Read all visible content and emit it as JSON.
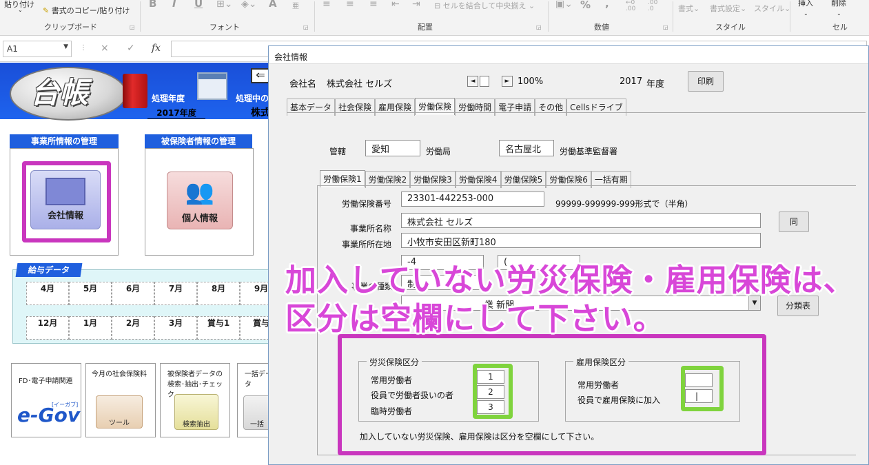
{
  "ribbon": {
    "paste_label": "貼り付け",
    "copy_format_label": "書式のコピー/貼り付け",
    "merge_label": "セルを結合して中央揃え",
    "percent": "%",
    "comma": ",",
    "inc_decimal": ".00",
    "dec_decimal": ".0",
    "cell_format": "書式",
    "format_settings": "書式設定",
    "style_btn": "スタイル",
    "insert": "挿入",
    "delete": "削除",
    "bold": "B",
    "italic": "I",
    "underline": "U",
    "font_color": "A",
    "groups": {
      "clipboard": "クリップボード",
      "font": "フォント",
      "alignment": "配置",
      "number": "数値",
      "style": "スタイル",
      "cells": "セル"
    }
  },
  "formula_bar": {
    "name_box": "A1",
    "cancel": "×",
    "enter": "✓",
    "fx": "fx",
    "value": ""
  },
  "sheet": {
    "logo_text": "台帳",
    "processing_year_label": "処理年度",
    "processing_year_value": "2017年度",
    "processing_company_label": "処理中の",
    "processing_company_value": "株式",
    "office_mgmt_header": "事業所情報の管理",
    "insured_mgmt_header": "被保険者情報の管理",
    "company_info_button": "会社情報",
    "personal_info_button": "個人情報",
    "salary_data_tab": "給与データ",
    "months_row1": [
      "4月",
      "5月",
      "6月",
      "7月",
      "8月",
      "9月"
    ],
    "months_row2": [
      "12月",
      "1月",
      "2月",
      "3月",
      "賞与1",
      "賞与"
    ],
    "tools": [
      {
        "title": "FD･電子申請関連",
        "icon_label": "e-Gov",
        "icon_sub": "[イーガブ]"
      },
      {
        "title": "今月の社会保険料",
        "icon_label": "ツール"
      },
      {
        "title": "被保険者データの検索･抽出･チェック",
        "icon_label": "検索抽出"
      },
      {
        "title": "一括データ",
        "icon_label": "一括"
      }
    ]
  },
  "dialog": {
    "title": "会社情報",
    "company_label": "会社名",
    "company_name": "株式会社 セルズ",
    "zoom_prev": "◄",
    "zoom_next": "►",
    "zoom": "100%",
    "year": "2017",
    "year_suffix": "年度",
    "print_button": "印刷",
    "tabs": [
      "基本データ",
      "社会保険",
      "雇用保険",
      "労働保険",
      "労働時間",
      "電子申請",
      "その他",
      "Cellsドライブ"
    ],
    "active_tab": "労働保険",
    "jurisdiction_label": "管轄",
    "prefecture": "愛知",
    "labor_bureau_label": "労働局",
    "inspection_office": "名古屋北",
    "inspection_office_label": "労働基準監督署",
    "sub_tabs": [
      "労働保険1",
      "労働保険2",
      "労働保険3",
      "労働保険4",
      "労働保険5",
      "労働保険6",
      "一括有期"
    ],
    "active_sub_tab": "労働保険1",
    "insurance_number_label": "労働保険番号",
    "insurance_number": "23301-442253-000",
    "insurance_number_format": "99999-999999-999形式で（半角）",
    "office_name_label": "事業所名称",
    "office_name": "株式会社 セルズ",
    "same_button": "同",
    "office_address_label": "事業所所在地",
    "office_address": "小牧市安田区新町180",
    "phone_partial": "-4",
    "other_partial": "(",
    "business_type_label": "事業の種類",
    "business_type_partial": "制",
    "category_partial": "業",
    "category_value_partial": "新聞",
    "category_label_partial": "",
    "classification_button": "分類表",
    "workers_comp_section": "労災保険区分",
    "workers_comp_rows": [
      {
        "label": "常用労働者",
        "value": "1"
      },
      {
        "label": "役員で労働者扱いの者",
        "value": "2"
      },
      {
        "label": "臨時労働者",
        "value": "3"
      }
    ],
    "employment_section": "雇用保険区分",
    "employment_rows": [
      {
        "label": "常用労働者",
        "value": ""
      },
      {
        "label": "役員で雇用保険に加入",
        "value": "|"
      }
    ],
    "note": "加入していない労災保険、雇用保険は区分を空欄にして下さい。"
  },
  "overlay": {
    "line1": "加入していない労災保険・雇用保険は、",
    "line2": "区分は空欄にして下さい。"
  },
  "colors": {
    "highlight_magenta": "#c936be",
    "highlight_green": "#7fd33d",
    "overlay_text": "#d847d8",
    "banner_blue": "#1f5fde"
  }
}
